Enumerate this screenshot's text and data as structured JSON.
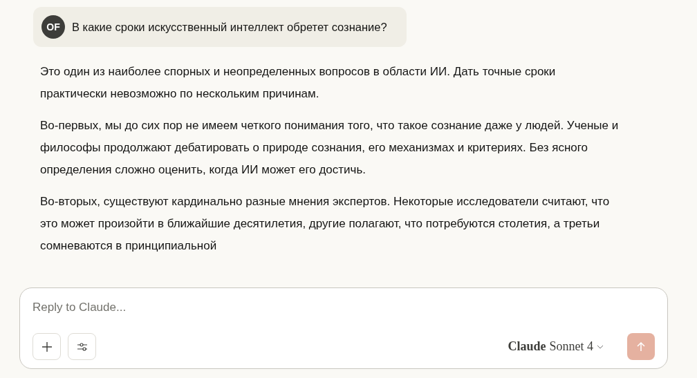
{
  "user_message": {
    "avatar": "OF",
    "text": "В какие сроки искусственный интеллект обретет сознание?"
  },
  "response": {
    "paragraphs": [
      "Это один из наиболее спорных и неопределенных вопросов в области ИИ. Дать точные сроки практически невозможно по нескольким причинам.",
      "Во-первых, мы до сих пор не имеем четкого понимания того, что такое сознание даже у людей. Ученые и философы продолжают дебатировать о природе сознания, его механизмах и критериях. Без ясного определения сложно оценить, когда ИИ может его достичь.",
      "Во-вторых, существуют кардинально разные мнения экспертов. Некоторые исследователи считают, что это может произойти в ближайшие десятилетия, другие полагают, что потребуются столетия, а третьи сомневаются в принципиальной"
    ]
  },
  "composer": {
    "placeholder": "Reply to Claude...",
    "model_brand": "Claude",
    "model_name": "Sonnet 4",
    "send_disabled": true
  }
}
